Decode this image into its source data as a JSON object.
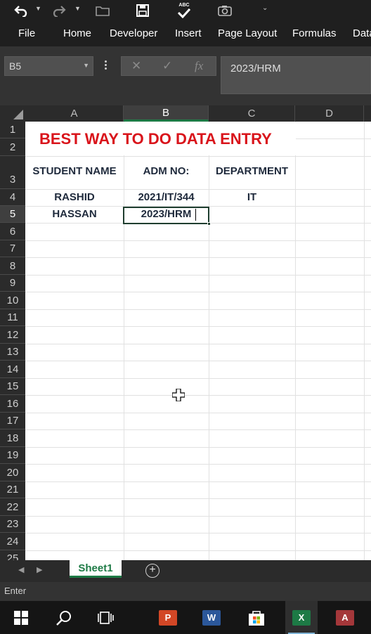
{
  "ribbon": {
    "tabs": [
      "File",
      "Home",
      "Developer",
      "Insert",
      "Page Layout",
      "Formulas",
      "Data"
    ],
    "spelling_label": "ABC"
  },
  "formula_bar": {
    "name_box": "B5",
    "cancel_glyph": "✕",
    "enter_glyph": "✓",
    "fx_glyph": "fx",
    "content": "2023/HRM"
  },
  "grid": {
    "columns": [
      "A",
      "B",
      "C",
      "D"
    ],
    "active_column": "B",
    "rows": [
      "1",
      "2",
      "3",
      "4",
      "5",
      "6",
      "7",
      "8",
      "9",
      "10",
      "11",
      "12",
      "13",
      "14",
      "15",
      "16",
      "17",
      "18",
      "19",
      "20",
      "21",
      "22",
      "23",
      "24",
      "25"
    ],
    "active_row": "5"
  },
  "sheet": {
    "title": "BEST WAY TO DO DATA ENTRY",
    "headers": [
      "STUDENT NAME",
      "ADM NO:",
      "DEPARTMENT"
    ],
    "records": [
      [
        "RASHID",
        "2021/IT/344",
        "IT"
      ],
      [
        "HASSAN",
        "2023/HRM",
        ""
      ]
    ],
    "title_color": "#d9141b"
  },
  "sheet_tabs": {
    "tabs": [
      "Sheet1"
    ],
    "add_glyph": "+"
  },
  "status": {
    "mode": "Enter"
  },
  "taskbar": {
    "apps": [
      "start",
      "search",
      "task-view",
      "powerpoint",
      "word",
      "store",
      "excel",
      "access"
    ],
    "powerpoint_letter": "P",
    "word_letter": "W",
    "excel_letter": "X",
    "access_letter": "A"
  },
  "colors": {
    "accent_excel": "#1d7a45",
    "chrome_dark": "#1f1f1f"
  }
}
